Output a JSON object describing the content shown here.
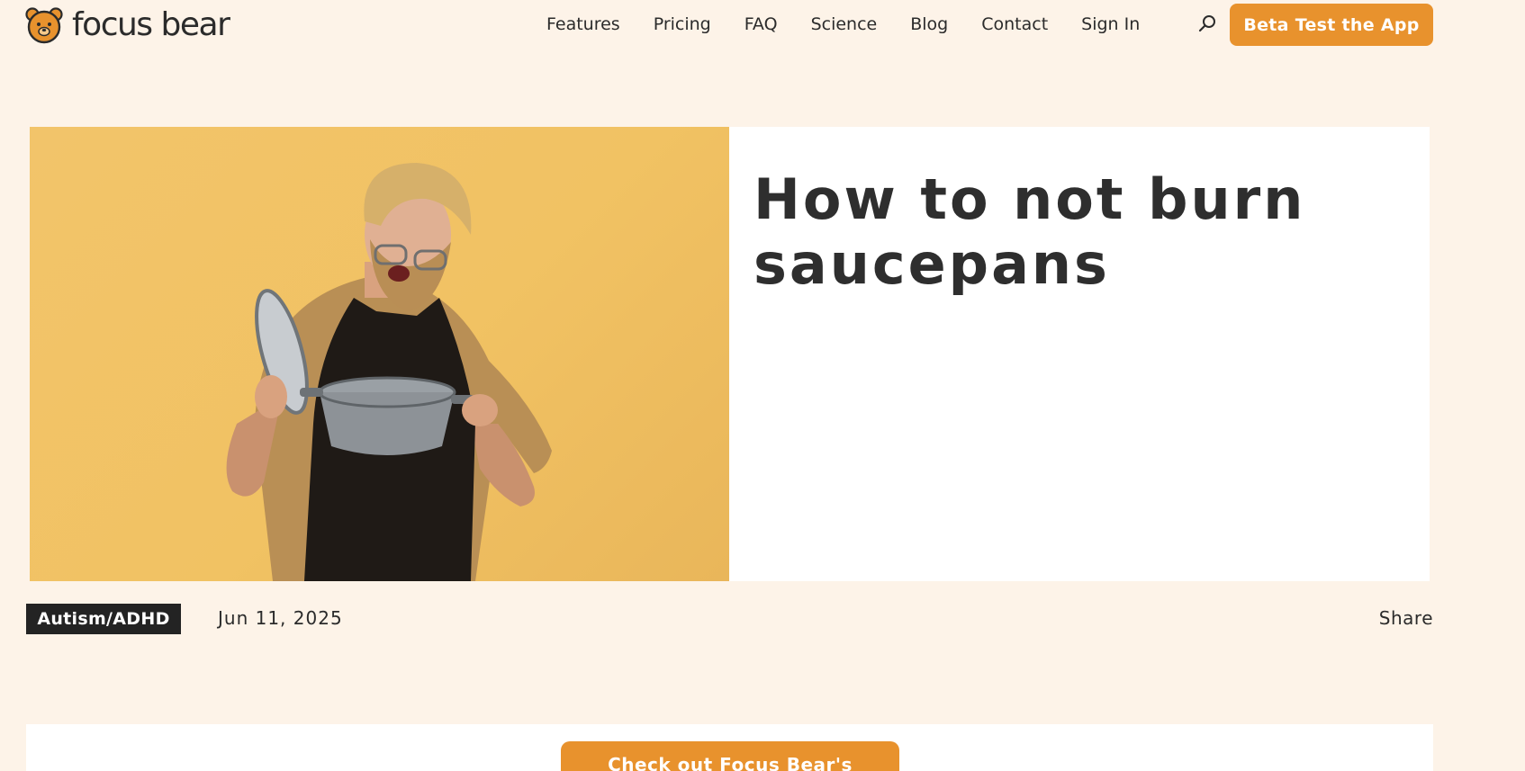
{
  "brand": {
    "name": "focus bear"
  },
  "nav": {
    "items": [
      {
        "label": "Features"
      },
      {
        "label": "Pricing"
      },
      {
        "label": "FAQ"
      },
      {
        "label": "Science"
      },
      {
        "label": "Blog"
      },
      {
        "label": "Contact"
      },
      {
        "label": "Sign In"
      }
    ],
    "search_icon": "search-icon",
    "cta_label": "Beta Test the App"
  },
  "article": {
    "title": "How to not burn saucepans",
    "category": "Autism/ADHD",
    "date": "Jun 11, 2025",
    "share_label": "Share",
    "hero_image": "man-looking-into-saucepan"
  },
  "promo": {
    "button_label": "Check out Focus Bear's"
  },
  "colors": {
    "background": "#fdf3e8",
    "accent": "#e8922d",
    "tag_background": "#232323",
    "hero_backdrop": "#f2c46a"
  }
}
